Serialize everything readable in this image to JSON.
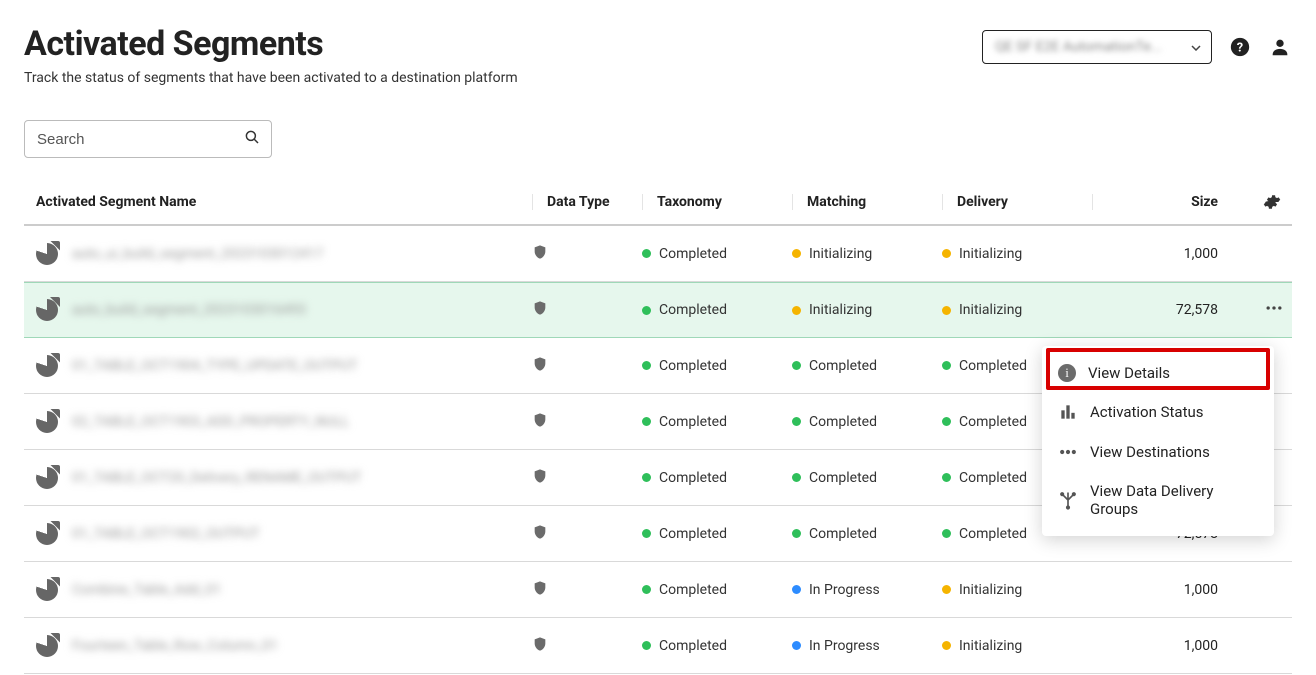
{
  "header": {
    "title": "Activated Segments",
    "subtitle": "Track the status of segments that have been activated to a destination platform",
    "project_selector": "QE SF E2E AutomationTe..."
  },
  "search": {
    "placeholder": "Search"
  },
  "columns": {
    "name": "Activated Segment Name",
    "data_type": "Data Type",
    "taxonomy": "Taxonomy",
    "matching": "Matching",
    "delivery": "Delivery",
    "size": "Size"
  },
  "statuses": {
    "completed": "Completed",
    "initializing": "Initializing",
    "in_progress": "In Progress"
  },
  "rows": [
    {
      "name": "auto_ui_build_segment_2023103012417",
      "taxonomy": "completed",
      "matching": "initializing",
      "delivery": "initializing",
      "size": "1,000",
      "highlight": false
    },
    {
      "name": "auto_build_segment_2023103016493",
      "taxonomy": "completed",
      "matching": "initializing",
      "delivery": "initializing",
      "size": "72,578",
      "highlight": true
    },
    {
      "name": "01_TABLE_OCT1904_TYPE_UPDATE_OUTPUT",
      "taxonomy": "completed",
      "matching": "completed",
      "delivery": "completed",
      "size": "",
      "highlight": false
    },
    {
      "name": "02_TABLE_OCT1903_ADD_PROPERTY_NULL",
      "taxonomy": "completed",
      "matching": "completed",
      "delivery": "completed",
      "size": "",
      "highlight": false
    },
    {
      "name": "01_TABLE_OCT20_Delivery_RENAME_OUTPUT",
      "taxonomy": "completed",
      "matching": "completed",
      "delivery": "completed",
      "size": "",
      "highlight": false
    },
    {
      "name": "01_TABLE_OCT1902_OUTPUT",
      "taxonomy": "completed",
      "matching": "completed",
      "delivery": "completed",
      "size": "72,578",
      "highlight": false
    },
    {
      "name": "Combine_Table_Add_01",
      "taxonomy": "completed",
      "matching": "in_progress",
      "delivery": "initializing",
      "size": "1,000",
      "highlight": false
    },
    {
      "name": "Fourteen_Table_Row_Column_01",
      "taxonomy": "completed",
      "matching": "in_progress",
      "delivery": "initializing",
      "size": "1,000",
      "highlight": false
    }
  ],
  "menu": {
    "view_details": "View Details",
    "activation_status": "Activation Status",
    "view_destinations": "View Destinations",
    "view_data_delivery_groups": "View Data Delivery Groups"
  }
}
